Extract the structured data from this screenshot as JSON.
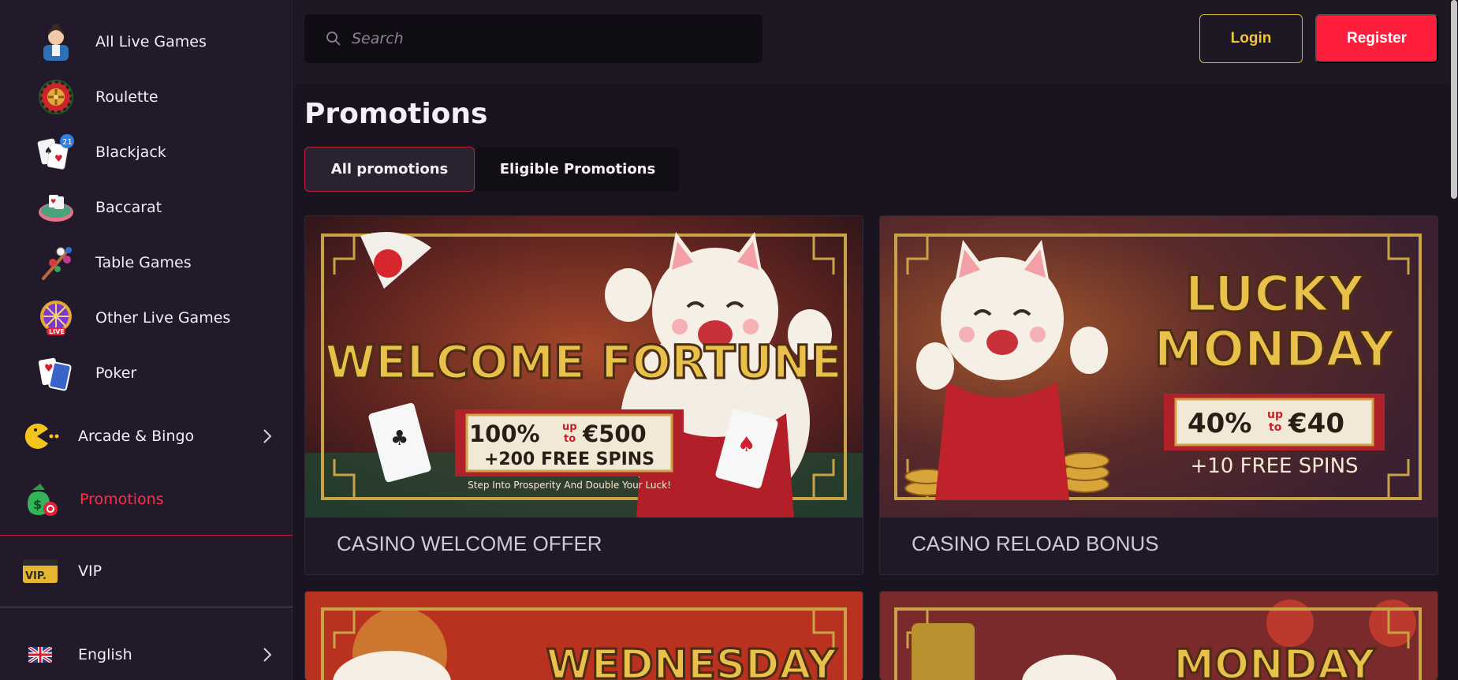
{
  "sidebar": {
    "items": [
      {
        "label": "All Live Games",
        "icon": "dealer-icon"
      },
      {
        "label": "Roulette",
        "icon": "roulette-icon"
      },
      {
        "label": "Blackjack",
        "icon": "blackjack-icon"
      },
      {
        "label": "Baccarat",
        "icon": "baccarat-icon"
      },
      {
        "label": "Table Games",
        "icon": "table-games-icon"
      },
      {
        "label": "Other Live Games",
        "icon": "other-live-icon"
      },
      {
        "label": "Poker",
        "icon": "poker-icon"
      }
    ],
    "arcade": {
      "label": "Arcade & Bingo",
      "icon": "pacman-icon"
    },
    "promotions": {
      "label": "Promotions",
      "icon": "money-bag-icon"
    },
    "vip": {
      "label": "VIP",
      "icon": "vip-icon"
    },
    "language": {
      "label": "English",
      "icon": "uk-flag-icon"
    }
  },
  "header": {
    "search_placeholder": "Search",
    "login_label": "Login",
    "register_label": "Register"
  },
  "main": {
    "title": "Promotions",
    "tabs": [
      {
        "label": "All promotions",
        "active": true
      },
      {
        "label": "Eligible Promotions",
        "active": false
      }
    ],
    "cards": [
      {
        "title": "CASINO WELCOME OFFER",
        "banner": {
          "headline": "WELCOME FORTUNE",
          "percent": "100%",
          "up": "up",
          "to": "to",
          "amount": "€500",
          "spins": "+200 FREE SPINS",
          "tagline": "Step Into Prosperity And Double Your Luck!"
        }
      },
      {
        "title": "CASINO RELOAD BONUS",
        "banner": {
          "line1": "LUCKY",
          "line2": "MONDAY",
          "percent": "40%",
          "up": "up",
          "to": "to",
          "amount": "€40",
          "spins": "+10 FREE SPINS"
        }
      },
      {
        "banner": {
          "headline": "WEDNESDAY"
        }
      },
      {
        "banner": {
          "headline": "MONDAY"
        }
      }
    ]
  },
  "colors": {
    "accent_red": "#ff1f3d",
    "accent_gold": "#e0b533",
    "sidebar_bg": "#221a2a",
    "page_bg": "#191420"
  }
}
